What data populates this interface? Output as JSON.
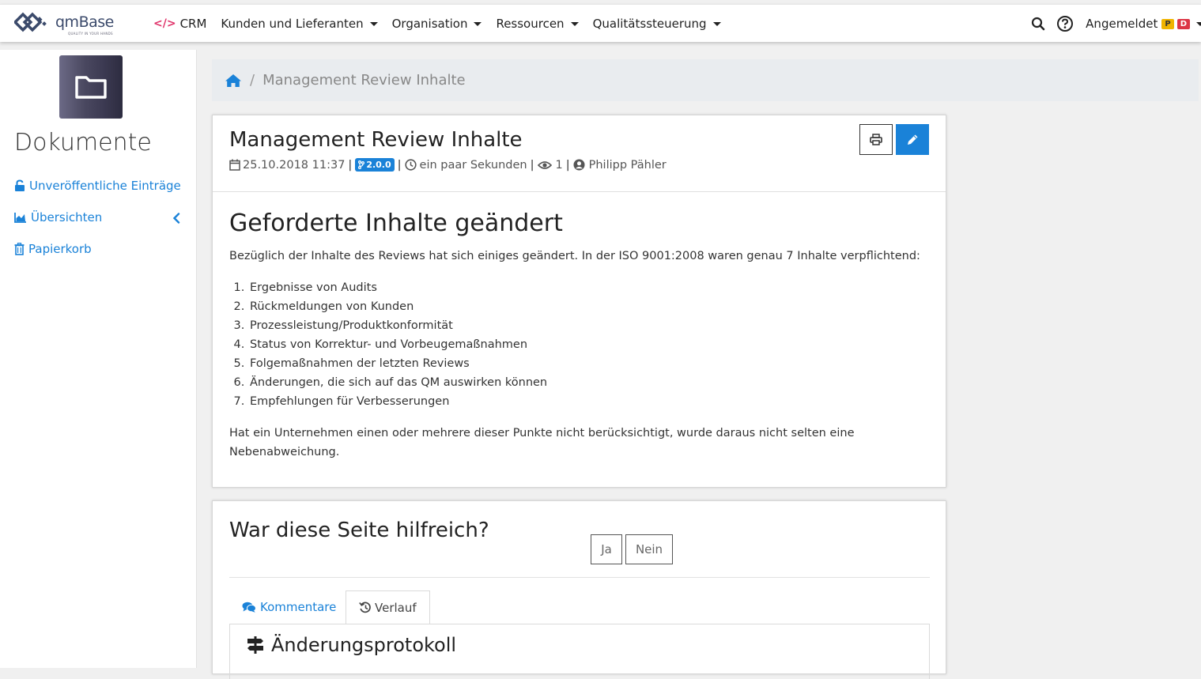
{
  "app": {
    "logo_text": "qmBase",
    "logo_tagline": "QUALITY IN YOUR HANDS"
  },
  "nav": {
    "items": [
      {
        "label": "CRM",
        "has_caret": false
      },
      {
        "label": "Kunden und Lieferanten",
        "has_caret": true
      },
      {
        "label": "Organisation",
        "has_caret": true
      },
      {
        "label": "Ressourcen",
        "has_caret": true
      },
      {
        "label": "Qualitätssteuerung",
        "has_caret": true
      }
    ],
    "user_label": "Angemeldet",
    "badge_p": "P",
    "badge_d": "D"
  },
  "sidebar": {
    "title": "Dokumente",
    "links": [
      {
        "label": "Unveröffentliche Einträge",
        "icon": "unlock-icon"
      },
      {
        "label": "Übersichten",
        "icon": "area-chart-icon"
      },
      {
        "label": "Papierkorb",
        "icon": "trash-icon"
      }
    ]
  },
  "breadcrumb": {
    "current": "Management Review Inhalte"
  },
  "document": {
    "title": "Management Review Inhalte",
    "date": "25.10.2018 11:37",
    "version": "2.0.0",
    "updated": "ein paar Sekunden",
    "views": "1",
    "author": "Philipp Pähler",
    "heading": "Geforderte Inhalte geändert",
    "intro": "Bezüglich der Inhalte des Reviews hat sich einiges  geändert. In der ISO 9001:2008 waren genau 7 Inhalte  verpflichtend:",
    "list": [
      "Ergebnisse von Audits",
      "Rückmeldungen von Kunden",
      "Prozessleistung/Produktkonformität",
      "Status von Korrektur- und Vorbeugemaßnahmen",
      "Folgemaßnahmen der letzten Reviews",
      "Änderungen, die sich auf das QM auswirken können",
      "Empfehlungen für Verbesserungen"
    ],
    "outro": "Hat ein Unternehmen einen oder mehrere dieser  Punkte nicht berücksichtigt, wurde daraus nicht  selten eine Nebenabweichung."
  },
  "feedback": {
    "title": "War diese Seite hilfreich?",
    "yes": "Ja",
    "no": "Nein",
    "tabs": [
      {
        "label": "Kommentare",
        "active": false
      },
      {
        "label": "Verlauf",
        "active": true
      }
    ],
    "panel_title": "Änderungsprotokoll"
  },
  "colors": {
    "accent": "#1a82d8",
    "crm_icon": "#e0356b",
    "badge_p": "#f0b400",
    "badge_d": "#dc3545"
  }
}
